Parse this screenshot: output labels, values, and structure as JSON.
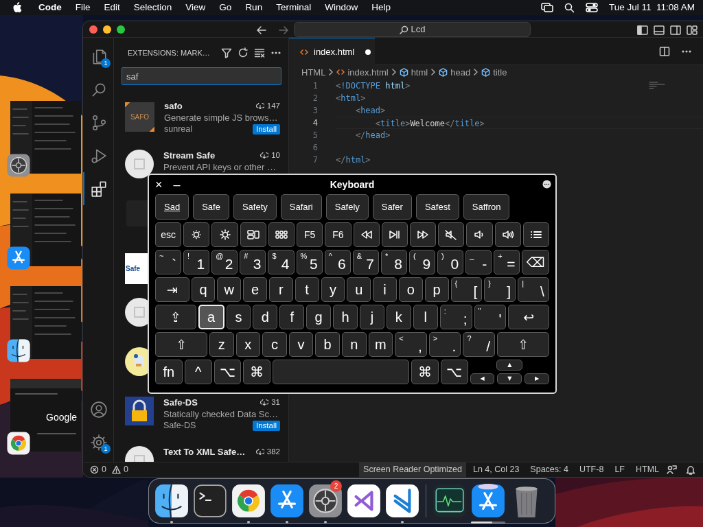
{
  "menu_bar": {
    "app": "Code",
    "items": [
      "File",
      "Edit",
      "Selection",
      "View",
      "Go",
      "Run",
      "Terminal",
      "Window",
      "Help"
    ],
    "clock": "Tue Jul 11  11:08 AM"
  },
  "stage": [
    {
      "kind": "settings"
    },
    {
      "kind": "store"
    },
    {
      "kind": "finder"
    },
    {
      "kind": "browser",
      "text": "Google"
    }
  ],
  "window": {
    "search": "Lcd"
  },
  "activity_bar": {
    "top": [
      {
        "kind": "files",
        "badge": "1",
        "selected": false
      },
      {
        "kind": "search",
        "selected": false
      },
      {
        "kind": "scm",
        "selected": false
      },
      {
        "kind": "run",
        "selected": false
      },
      {
        "kind": "extensions",
        "selected": true
      }
    ],
    "bottom": [
      {
        "kind": "account"
      },
      {
        "kind": "gear",
        "badge": "1"
      }
    ]
  },
  "sidebar": {
    "title": "EXTENSIONS: MARK…",
    "search": {
      "value": "saf"
    },
    "extensions": [
      {
        "kind": "full",
        "name": "safo",
        "icon_text": "SAFO",
        "description": "Generate simple JS brows…",
        "publisher": "sunreal",
        "downloads": "147",
        "button": "Install"
      },
      {
        "kind": "partial",
        "name": "Stream Safe",
        "description": "Prevent API keys or other …",
        "downloads": "10"
      },
      {
        "kind": "covered"
      },
      {
        "kind": "covered",
        "icon_text": "Safe"
      },
      {
        "kind": "covered"
      },
      {
        "kind": "covered"
      },
      {
        "kind": "full",
        "name": "Safe-DS",
        "description": "Statically checked Data Sc…",
        "publisher": "Safe-DS",
        "downloads": "31",
        "button": "Install"
      },
      {
        "kind": "partial",
        "name": "Text To XML Safe…",
        "downloads": "382"
      }
    ]
  },
  "editor": {
    "tab": {
      "label": "index.html",
      "modified": true,
      "selected": true
    },
    "breadcrumbs": [
      {
        "kind": "language",
        "label": "HTML"
      },
      {
        "kind": "file",
        "label": "index.html"
      },
      {
        "kind": "element",
        "label": "html"
      },
      {
        "kind": "element",
        "label": "head"
      },
      {
        "kind": "element",
        "label": "title"
      }
    ],
    "lines": [
      {
        "number": "1",
        "current": false,
        "tokens": [
          {
            "kind": "punct",
            "text": "<"
          },
          {
            "kind": "keyword",
            "text": "!DOCTYPE "
          },
          {
            "kind": "attr",
            "text": "html"
          },
          {
            "kind": "punct",
            "text": ">"
          }
        ]
      },
      {
        "number": "2",
        "current": false,
        "tokens": [
          {
            "kind": "punct",
            "text": "<"
          },
          {
            "kind": "tag",
            "text": "html"
          },
          {
            "kind": "punct",
            "text": ">"
          }
        ]
      },
      {
        "number": "3",
        "current": false,
        "tokens": [
          {
            "kind": "punct",
            "text": "    <"
          },
          {
            "kind": "tag",
            "text": "head"
          },
          {
            "kind": "punct",
            "text": ">"
          }
        ]
      },
      {
        "number": "4",
        "current": true,
        "tokens": [
          {
            "kind": "punct",
            "text": "        <"
          },
          {
            "kind": "tag",
            "text": "title"
          },
          {
            "kind": "punct",
            "text": ">"
          },
          {
            "kind": "text",
            "text": "Welcome"
          },
          {
            "kind": "punct",
            "text": "</"
          },
          {
            "kind": "tag",
            "text": "title"
          },
          {
            "kind": "punct",
            "text": ">"
          }
        ]
      },
      {
        "number": "5",
        "current": false,
        "tokens": [
          {
            "kind": "punct",
            "text": "    </"
          },
          {
            "kind": "tag",
            "text": "head"
          },
          {
            "kind": "punct",
            "text": ">"
          }
        ]
      },
      {
        "number": "6",
        "current": false
      },
      {
        "number": "7",
        "current": false,
        "tokens": [
          {
            "kind": "punct",
            "text": "</"
          },
          {
            "kind": "tag",
            "text": "html"
          },
          {
            "kind": "punct",
            "text": ">"
          }
        ]
      }
    ]
  },
  "keyboard": {
    "title": "Keyboard",
    "close": "×",
    "minimize": "–",
    "suggestions": [
      {
        "label": "Sad",
        "selected": true
      },
      {
        "label": "Safe",
        "selected": false
      },
      {
        "label": "Safety",
        "selected": false
      },
      {
        "label": "Safari",
        "selected": false
      },
      {
        "label": "Safely",
        "selected": false
      },
      {
        "label": "Safer",
        "selected": false
      },
      {
        "label": "Safest",
        "selected": false
      },
      {
        "label": "Saffron",
        "selected": false
      }
    ],
    "rows": [
      {
        "keys": [
          {
            "kind": "char",
            "label": "esc"
          },
          {
            "kind": "brightness-down"
          },
          {
            "kind": "brightness-up"
          },
          {
            "kind": "mission-control"
          },
          {
            "kind": "launchpad"
          },
          {
            "kind": "char",
            "label": "F5"
          },
          {
            "kind": "char",
            "label": "F6"
          },
          {
            "kind": "rewind"
          },
          {
            "kind": "play-pause"
          },
          {
            "kind": "fast-forward"
          },
          {
            "kind": "mute"
          },
          {
            "kind": "volume-down"
          },
          {
            "kind": "volume-up"
          },
          {
            "kind": "list"
          }
        ]
      },
      {
        "keys": [
          {
            "kind": "char",
            "shift": "~",
            "label": "`"
          },
          {
            "kind": "char",
            "shift": "!",
            "label": "1"
          },
          {
            "kind": "char",
            "shift": "@",
            "label": "2"
          },
          {
            "kind": "char",
            "shift": "#",
            "label": "3"
          },
          {
            "kind": "char",
            "shift": "$",
            "label": "4"
          },
          {
            "kind": "char",
            "shift": "%",
            "label": "5"
          },
          {
            "kind": "char",
            "shift": "^",
            "label": "6"
          },
          {
            "kind": "char",
            "shift": "&",
            "label": "7"
          },
          {
            "kind": "char",
            "shift": "*",
            "label": "8"
          },
          {
            "kind": "char",
            "shift": "(",
            "label": "9"
          },
          {
            "kind": "char",
            "shift": ")",
            "label": "0"
          },
          {
            "kind": "char",
            "shift": "_",
            "label": "-"
          },
          {
            "kind": "char",
            "shift": "+",
            "label": "="
          },
          {
            "kind": "delete",
            "label": "⌫"
          }
        ]
      },
      {
        "keys": [
          {
            "kind": "tab",
            "label": "⇥"
          },
          {
            "kind": "char",
            "label": "q"
          },
          {
            "kind": "char",
            "label": "w"
          },
          {
            "kind": "char",
            "label": "e"
          },
          {
            "kind": "char",
            "label": "r"
          },
          {
            "kind": "char",
            "label": "t"
          },
          {
            "kind": "char",
            "label": "y"
          },
          {
            "kind": "char",
            "label": "u"
          },
          {
            "kind": "char",
            "label": "i"
          },
          {
            "kind": "char",
            "label": "o"
          },
          {
            "kind": "char",
            "label": "p"
          },
          {
            "kind": "char",
            "shift": "{",
            "label": "["
          },
          {
            "kind": "char",
            "shift": "}",
            "label": "]"
          },
          {
            "kind": "char",
            "shift": "|",
            "label": "\\"
          }
        ]
      },
      {
        "keys": [
          {
            "kind": "caps",
            "label": "⇪",
            "pressed": false
          },
          {
            "kind": "char",
            "label": "a",
            "pressed": true
          },
          {
            "kind": "char",
            "label": "s",
            "pressed": false
          },
          {
            "kind": "char",
            "label": "d",
            "pressed": false
          },
          {
            "kind": "char",
            "label": "f",
            "pressed": false
          },
          {
            "kind": "char",
            "label": "g",
            "pressed": false
          },
          {
            "kind": "char",
            "label": "h",
            "pressed": false
          },
          {
            "kind": "char",
            "label": "j",
            "pressed": false
          },
          {
            "kind": "char",
            "label": "k",
            "pressed": false
          },
          {
            "kind": "char",
            "label": "l",
            "pressed": false
          },
          {
            "kind": "char",
            "shift": ":",
            "label": ";",
            "pressed": false
          },
          {
            "kind": "char",
            "shift": "\"",
            "label": "'",
            "pressed": false
          },
          {
            "kind": "return",
            "label": "↩",
            "pressed": false
          }
        ]
      },
      {
        "keys": [
          {
            "kind": "shift",
            "label": "⇧"
          },
          {
            "kind": "char",
            "label": "z"
          },
          {
            "kind": "char",
            "label": "x"
          },
          {
            "kind": "char",
            "label": "c"
          },
          {
            "kind": "char",
            "label": "v"
          },
          {
            "kind": "char",
            "label": "b"
          },
          {
            "kind": "char",
            "label": "n"
          },
          {
            "kind": "char",
            "label": "m"
          },
          {
            "kind": "char",
            "shift": "<",
            "label": ","
          },
          {
            "kind": "char",
            "shift": ">",
            "label": "."
          },
          {
            "kind": "char",
            "shift": "?",
            "label": "/"
          },
          {
            "kind": "shift",
            "label": "⇧"
          }
        ]
      },
      {
        "keys": [
          {
            "kind": "char",
            "label": "fn"
          },
          {
            "kind": "char",
            "label": "^"
          },
          {
            "kind": "char",
            "label": "⌥"
          },
          {
            "kind": "char",
            "label": "⌘"
          },
          {
            "kind": "space"
          },
          {
            "kind": "char",
            "label": "⌘"
          },
          {
            "kind": "char",
            "label": "⌥"
          },
          {
            "kind": "arrows",
            "up": "▲",
            "left": "◀",
            "down": "▼",
            "right": "▶"
          }
        ]
      }
    ]
  },
  "status_bar": {
    "problems": [
      {
        "kind": "error",
        "count": "0"
      },
      {
        "kind": "warning",
        "count": "0"
      }
    ],
    "items": [
      {
        "label": "Screen Reader Optimized",
        "highlighted": true
      },
      {
        "label": "Ln 4, Col 23",
        "highlighted": false
      },
      {
        "label": "Spaces: 4",
        "highlighted": false
      },
      {
        "label": "UTF-8",
        "highlighted": false
      },
      {
        "label": "LF",
        "highlighted": false
      },
      {
        "label": "HTML",
        "highlighted": false
      }
    ]
  },
  "dock": [
    {
      "kind": "finder",
      "running": true
    },
    {
      "kind": "terminal",
      "running": false
    },
    {
      "kind": "chrome",
      "running": true
    },
    {
      "kind": "store",
      "running": true
    },
    {
      "kind": "settings",
      "running": true,
      "badge": "2"
    },
    {
      "kind": "vstudio",
      "running": false
    },
    {
      "kind": "vscode",
      "running": true
    },
    {
      "kind": "separator"
    },
    {
      "kind": "activity",
      "running": false
    },
    {
      "kind": "store-download",
      "running": false,
      "level": 0.62
    },
    {
      "kind": "trash",
      "running": false
    }
  ]
}
